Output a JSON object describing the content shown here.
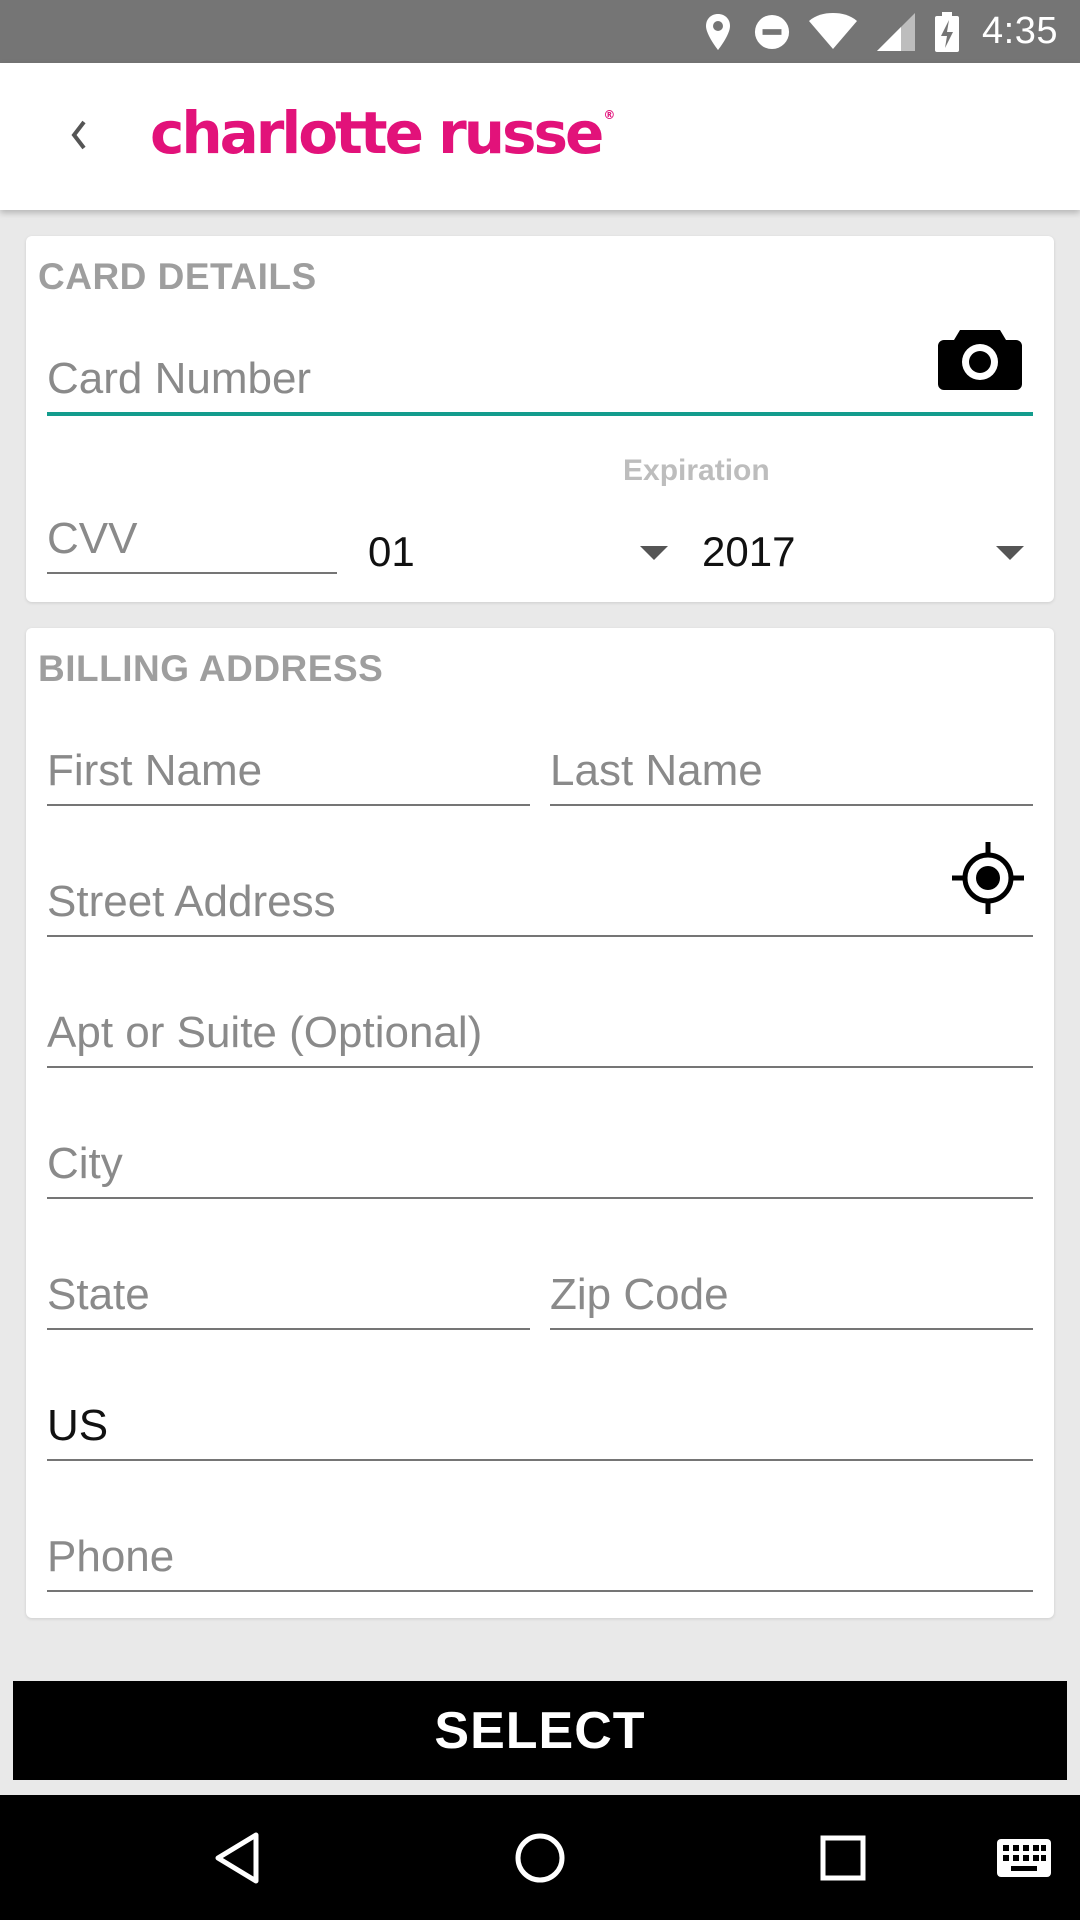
{
  "status_bar": {
    "time": "4:35",
    "icons": [
      "location-icon",
      "do-not-disturb-icon",
      "wifi-icon",
      "signal-icon",
      "battery-charging-icon"
    ]
  },
  "app_bar": {
    "back_icon": "chevron-left-icon",
    "brand": "charlotte russe"
  },
  "card_details": {
    "title": "CARD DETAILS",
    "card_number_placeholder": "Card Number",
    "camera_icon": "camera-icon",
    "cvv_placeholder": "CVV",
    "expiration_label": "Expiration",
    "exp_month": "01",
    "exp_year": "2017",
    "focus_color": "#139c8d"
  },
  "billing_address": {
    "title": "BILLING ADDRESS",
    "first_name_placeholder": "First Name",
    "last_name_placeholder": "Last Name",
    "street_placeholder": "Street Address",
    "location_icon": "gps-target-icon",
    "apt_placeholder": "Apt or Suite (Optional)",
    "city_placeholder": "City",
    "state_placeholder": "State",
    "zip_placeholder": "Zip Code",
    "country_value": "US",
    "phone_placeholder": "Phone"
  },
  "action": {
    "select_label": "SELECT"
  },
  "nav_bar": {
    "icons": [
      "back-triangle-icon",
      "home-circle-icon",
      "recents-square-icon",
      "keyboard-icon"
    ]
  },
  "colors": {
    "brand": "#e2127a",
    "status_bar": "#757575",
    "button": "#000000"
  }
}
